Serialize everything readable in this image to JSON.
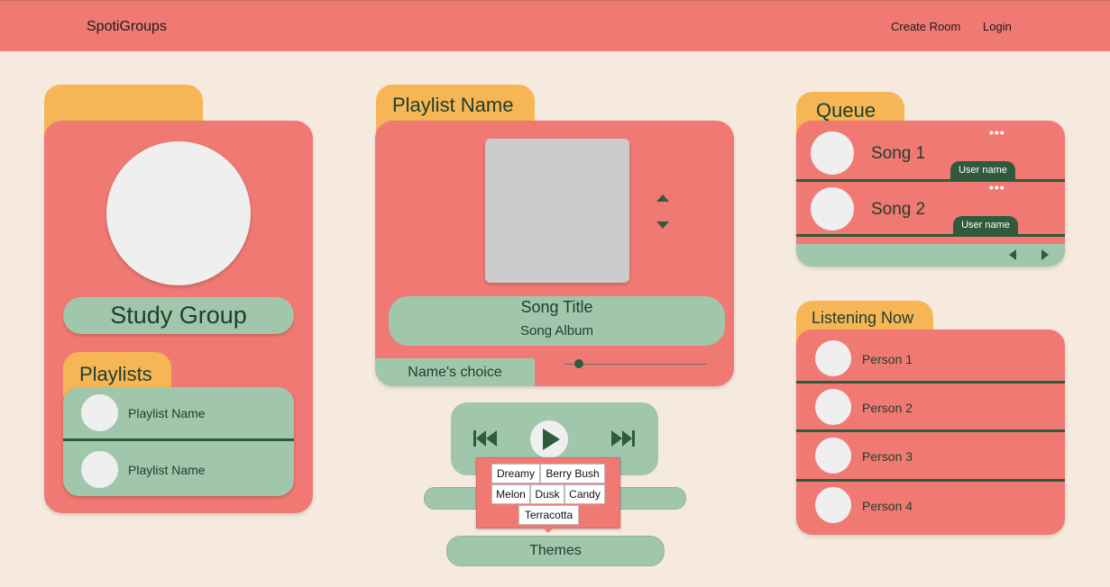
{
  "app": {
    "brand": "SpotiGroups",
    "nav": {
      "create_room": "Create Room",
      "login": "Login"
    }
  },
  "group": {
    "name": "Study Group",
    "playlists_title": "Playlists",
    "playlists": [
      {
        "name": "Playlist Name"
      },
      {
        "name": "Playlist Name"
      }
    ]
  },
  "player": {
    "playlist_title": "Playlist Name",
    "song_title": "Song Title",
    "song_album": "Song Album",
    "chooser": "Name's choice",
    "progress": 0.1
  },
  "queue": {
    "title": "Queue",
    "items": [
      {
        "song": "Song 1",
        "user": "User name"
      },
      {
        "song": "Song 2",
        "user": "User name"
      }
    ]
  },
  "listening": {
    "title": "Listening Now",
    "people": [
      "Person 1",
      "Person 2",
      "Person 3",
      "Person 4"
    ]
  },
  "themes": {
    "button_label": "Themes",
    "options": [
      "Dreamy",
      "Berry Bush",
      "Melon",
      "Dusk",
      "Candy",
      "Terracotta"
    ]
  },
  "colors": {
    "background": "#f6eadf",
    "primary": "#f07a73",
    "accent": "#f7b655",
    "green": "#a0c7ac",
    "dark_green": "#2f5a3c"
  }
}
